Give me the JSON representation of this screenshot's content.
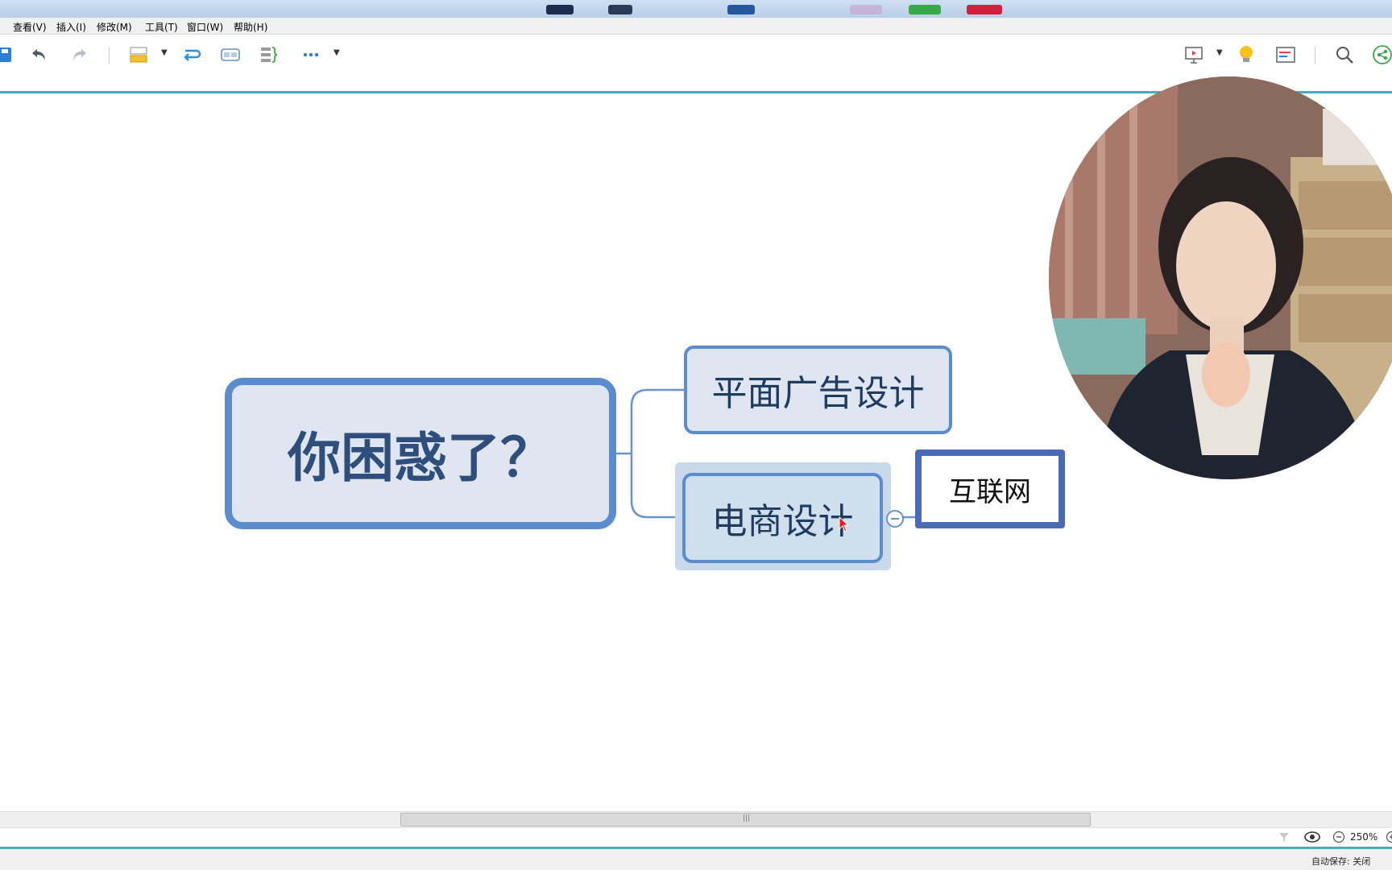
{
  "menu": {
    "items": [
      "查看(V)",
      "插入(I)",
      "修改(M)",
      "工具(T)",
      "窗口(W)",
      "帮助(H)"
    ]
  },
  "toolbar": {
    "icons": [
      "save-icon",
      "undo-icon",
      "redo-icon",
      "topic-style-icon",
      "relationship-icon",
      "boundary-icon",
      "summary-icon",
      "more-icon",
      "presentation-icon",
      "idea-bulb-icon",
      "outline-icon",
      "search-icon",
      "share-icon"
    ]
  },
  "mindmap": {
    "central_topic": "你困惑了？",
    "subtopics": [
      {
        "label": "平面广告设计"
      },
      {
        "label": "电商设计",
        "selected": true,
        "children": [
          "互联网"
        ]
      }
    ],
    "colors": {
      "topic_fill": "#dfe6f1",
      "topic_border": "#5b8ccd",
      "child_border": "#4a6ab8",
      "connector": "#6a93c9"
    }
  },
  "status": {
    "zoom": "250%",
    "autosave_label": "自动保存: 关闭"
  }
}
